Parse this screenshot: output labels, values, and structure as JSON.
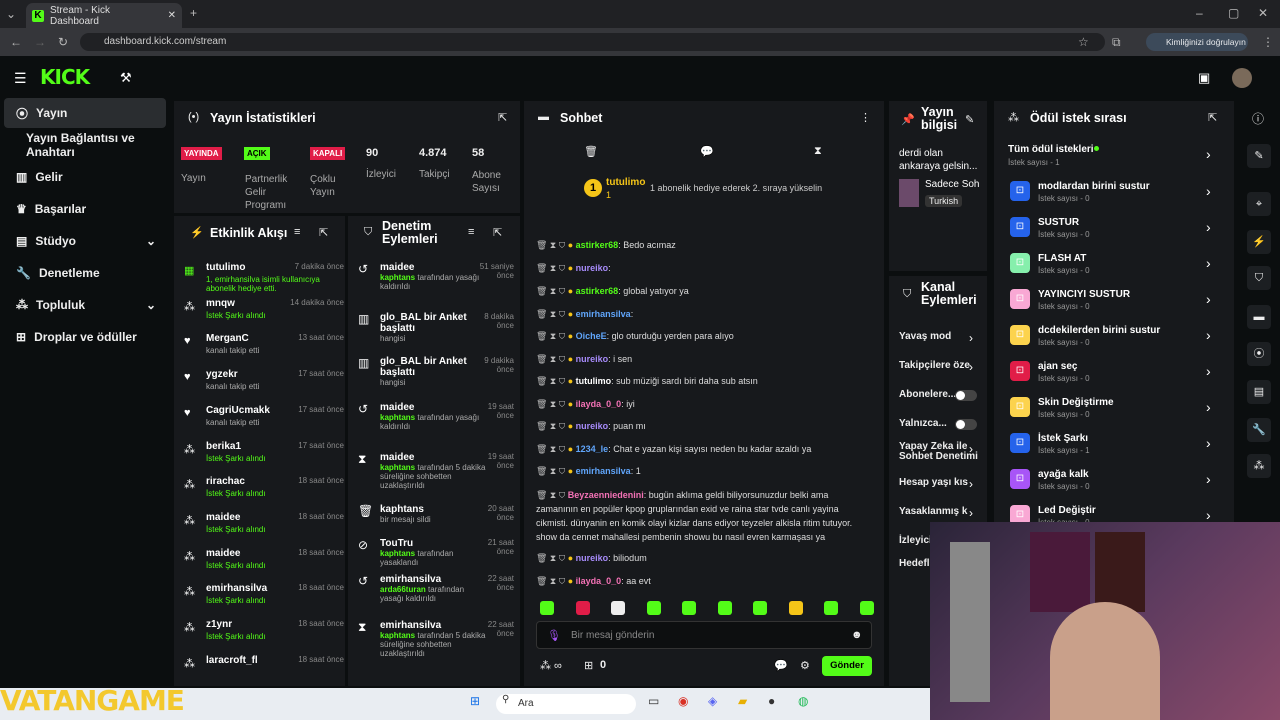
{
  "browser": {
    "tab_title": "Stream - Kick Dashboard",
    "url": "dashboard.kick.com/stream",
    "profile_btn": "Kimliğinizi doğrulayın"
  },
  "sidebar": {
    "items": [
      {
        "label": "Yayın"
      },
      {
        "label": "Yayın Bağlantısı ve Anahtarı"
      },
      {
        "label": "Gelir"
      },
      {
        "label": "Başarılar"
      },
      {
        "label": "Stüdyo"
      },
      {
        "label": "Denetleme"
      },
      {
        "label": "Topluluk"
      },
      {
        "label": "Droplar ve ödüller"
      }
    ]
  },
  "stats": {
    "title": "Yayın İstatistikleri",
    "live_badge": "YAYINDA",
    "live_label": "Yayın",
    "partner_badge": "AÇIK",
    "partner_label": "Partnerlik Gelir Programı",
    "multi_badge": "KAPALI",
    "multi_label": "Çoklu Yayın",
    "viewers": "90",
    "viewers_label": "İzleyici",
    "followers": "4.874",
    "followers_label": "Takipçi",
    "subs": "58",
    "subs_label": "Abone Sayısı"
  },
  "activity": {
    "title": "Etkinlik Akışı",
    "rows": [
      {
        "name": "tutulimo",
        "sub": "1, emirhansilva isimli kullanıcıya abonelik hediye etti.",
        "time": "7 dakika önce"
      },
      {
        "name": "mnqw",
        "sub": "İstek Şarkı alındı",
        "time": "14 dakika önce"
      },
      {
        "name": "MerganC",
        "sub": "kanalı takip etti",
        "time": "13 saat önce"
      },
      {
        "name": "ygzekr",
        "sub": "kanalı takip etti",
        "time": "17 saat önce"
      },
      {
        "name": "CagriUcmakk",
        "sub": "kanalı takip etti",
        "time": "17 saat önce"
      },
      {
        "name": "berika1",
        "sub": "İstek Şarkı alındı",
        "time": "17 saat önce"
      },
      {
        "name": "rirachac",
        "sub": "İstek Şarkı alındı",
        "time": "18 saat önce"
      },
      {
        "name": "maidee",
        "sub": "İstek Şarkı alındı",
        "time": "18 saat önce"
      },
      {
        "name": "maidee",
        "sub": "İstek Şarkı alındı",
        "time": "18 saat önce"
      },
      {
        "name": "emirhansilva",
        "sub": "İstek Şarkı alındı",
        "time": "18 saat önce"
      },
      {
        "name": "z1ynr",
        "sub": "İstek Şarkı alındı",
        "time": "18 saat önce"
      },
      {
        "name": "laracroft_fl",
        "sub": "",
        "time": "18 saat önce"
      }
    ]
  },
  "mod": {
    "title": "Denetim Eylemleri",
    "rows": [
      {
        "name": "maidee",
        "sub1": "kaphtans",
        "sub2": "tarafından yasağı kaldırıldı",
        "time": "51 saniye önce"
      },
      {
        "name": "glo_BAL bir Anket başlattı",
        "sub1": "",
        "sub2": "hangisi",
        "time": "8 dakika önce"
      },
      {
        "name": "glo_BAL bir Anket başlattı",
        "sub1": "",
        "sub2": "hangisi",
        "time": "9 dakika önce"
      },
      {
        "name": "maidee",
        "sub1": "kaphtans",
        "sub2": "tarafından yasağı kaldırıldı",
        "time": "19 saat önce"
      },
      {
        "name": "maidee",
        "sub1": "kaphtans",
        "sub2": "tarafından 5 dakika süreliğine sohbetten uzaklaştırıldı",
        "time": "19 saat önce"
      },
      {
        "name": "kaphtans",
        "sub1": "",
        "sub2": "bir mesajı sildi",
        "time": "20 saat önce"
      },
      {
        "name": "TouTru",
        "sub1": "kaphtans",
        "sub2": "tarafından yasaklandı",
        "time": "21 saat önce"
      },
      {
        "name": "emirhansilva",
        "sub1": "arda66turan",
        "sub2": "tarafından yasağı kaldırıldı",
        "time": "22 saat önce"
      },
      {
        "name": "emirhansilva",
        "sub1": "kaphtans",
        "sub2": "tarafından 5 dakika süreliğine sohbetten uzaklaştırıldı",
        "time": "22 saat önce"
      }
    ]
  },
  "chat": {
    "title": "Sohbet",
    "gift_user": "tutulimo",
    "gift_count": "1",
    "gift_msg": "1 abonelik hediye ederek 2. sıraya yükselin",
    "placeholder": "Bir mesaj gönderin",
    "send": "Gönder",
    "bottom_count": "0",
    "lines": [
      {
        "user": "astirker68",
        "color": "#53fc18",
        "msg": ": Bedo acımaz"
      },
      {
        "user": "nureiko",
        "color": "#a78bfa",
        "msg": ":"
      },
      {
        "user": "astirker68",
        "color": "#53fc18",
        "msg": ": global yatıyor ya"
      },
      {
        "user": "emirhansilva",
        "color": "#60a5fa",
        "msg": ":"
      },
      {
        "user": "OicheE",
        "color": "#60a5fa",
        "msg": ": glo oturduğu yerden para alıyo"
      },
      {
        "user": "nureiko",
        "color": "#a78bfa",
        "msg": ": i sen"
      },
      {
        "user": "tutulimo",
        "color": "#ffffff",
        "msg": ": sub müziği sardı biri daha sub atsın"
      },
      {
        "user": "ilayda_0_0",
        "color": "#f472b6",
        "msg": ": iyi"
      },
      {
        "user": "nureiko",
        "color": "#a78bfa",
        "msg": ": puan mı"
      },
      {
        "user": "1234_le",
        "color": "#60a5fa",
        "msg": ": Chat e yazan kişi sayısı neden bu kadar azaldı ya"
      },
      {
        "user": "emirhansilva",
        "color": "#60a5fa",
        "msg": ": 1"
      },
      {
        "user": "nureiko",
        "color": "#a78bfa",
        "msg": ": biliodum"
      },
      {
        "user": "ilayda_0_0",
        "color": "#f472b6",
        "msg": ": aa evt"
      }
    ],
    "long_user": "Beyzaenniedenini",
    "long_msg": [
      ": bugün aklıma geldi biliyorsunuzdur belki ama",
      "zamanının en popüler kpop gruplarından exid ve raina star tvde canlı yayina",
      "cikmisti. dünyanin en komik olayi kizlar dans ediyor teyzeler alkisla ritim tutuyor.",
      "show da cennet mahallesi pembenin showu bu nasıl evren karmaşası ya"
    ]
  },
  "info": {
    "title": "Yayın bilgisi",
    "text": "derdi olan ankaraya gelsin...",
    "category": "Sadece Soh",
    "tag": "Turkish"
  },
  "channel": {
    "title": "Kanal Eylemleri",
    "rows": [
      "Yavaş mod",
      "Takipçilere öze",
      "Abonelere...",
      "Yalnızca...",
      "Yapay Zeka ile Sohbet Denetimi",
      "Hesap yaşı kıs",
      "Yasaklanmış k",
      "İzleyici",
      "Hedefl"
    ]
  },
  "rewards": {
    "title": "Ödül istek sırası",
    "header": "Tüm ödül istekleri",
    "header_sub": "İstek sayısı - 1",
    "rows": [
      {
        "t": "modlardan birini sustur",
        "s": "İstek sayısı - 0",
        "c": "#2563eb"
      },
      {
        "t": "SUSTUR",
        "s": "İstek sayısı - 0",
        "c": "#2563eb"
      },
      {
        "t": "FLASH AT",
        "s": "İstek sayısı - 0",
        "c": "#86efac"
      },
      {
        "t": "YAYINCIYI SUSTUR",
        "s": "İstek sayısı - 0",
        "c": "#f9a8d4"
      },
      {
        "t": "dcdekilerden birini sustur",
        "s": "İstek sayısı - 0",
        "c": "#fcd34d"
      },
      {
        "t": "ajan seç",
        "s": "İstek sayısı - 0",
        "c": "#e11d48"
      },
      {
        "t": "Skin Değiştirme",
        "s": "İstek sayısı - 0",
        "c": "#fcd34d"
      },
      {
        "t": "İstek Şarkı",
        "s": "İstek sayısı - 1",
        "c": "#2563eb"
      },
      {
        "t": "ayağa kalk",
        "s": "İstek sayısı - 0",
        "c": "#a855f7"
      },
      {
        "t": "Led Değiştir",
        "s": "İstek sayısı - 0",
        "c": "#f9a8d4"
      }
    ]
  },
  "taskbar": {
    "search": "Ara",
    "watermark": "VATANGAME"
  }
}
